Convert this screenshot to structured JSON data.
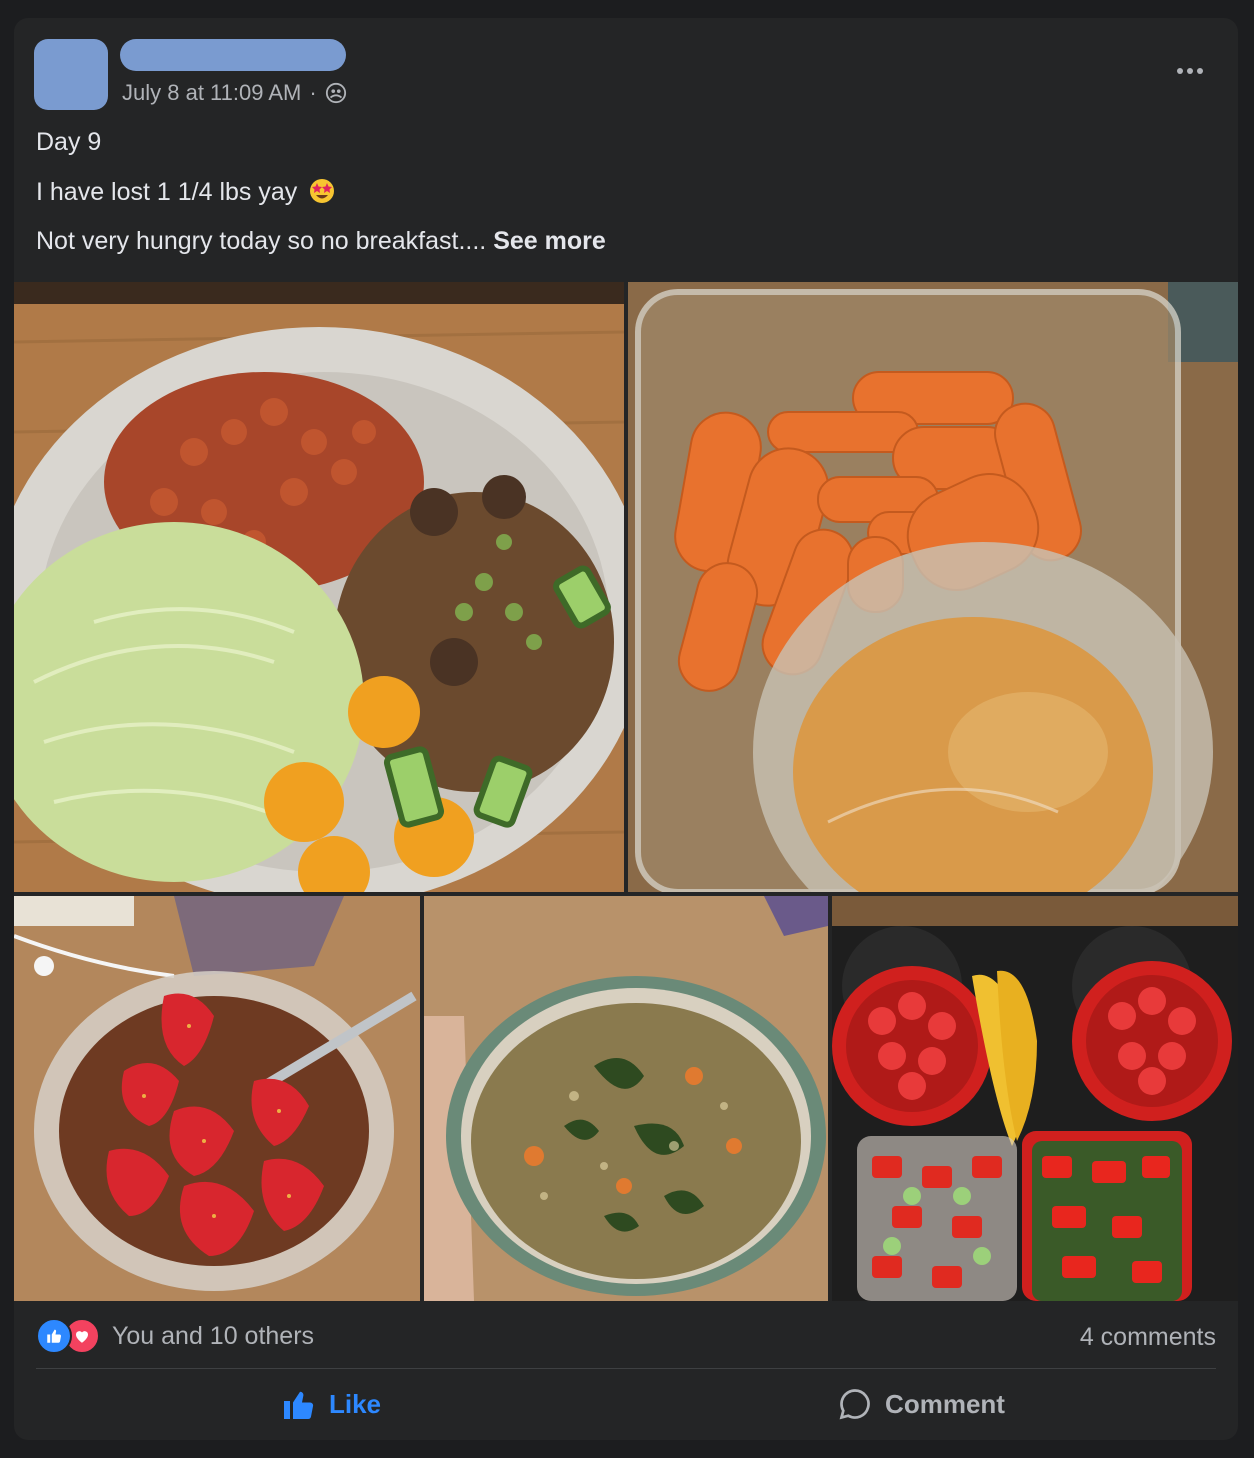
{
  "post": {
    "timestamp": "July 8 at 11:09 AM",
    "separator": "·",
    "audience_icon": "friends-icon",
    "lines": {
      "day": "Day 9",
      "lost": "I have lost 1 1/4 lbs yay",
      "hungry": "Not very hungry today so no breakfast.... ",
      "see_more": "See more"
    },
    "emoji": "star-struck-emoji",
    "photos": [
      {
        "name": "chickpea-salad-bowl-photo"
      },
      {
        "name": "carrots-hummus-photo"
      },
      {
        "name": "strawberries-yogurt-photo"
      },
      {
        "name": "lentil-soup-photo"
      },
      {
        "name": "meal-prep-containers-photo"
      }
    ]
  },
  "footer": {
    "reactions_text": "You and 10 others",
    "comments_text": "4 comments",
    "like_label": "Like",
    "comment_label": "Comment"
  },
  "colors": {
    "background": "#1c1d1f",
    "card": "#242526",
    "placeholder": "#7a9bd0",
    "accent": "#2d88ff",
    "love": "#f3425f",
    "secondary_text": "#b0b3b8"
  }
}
